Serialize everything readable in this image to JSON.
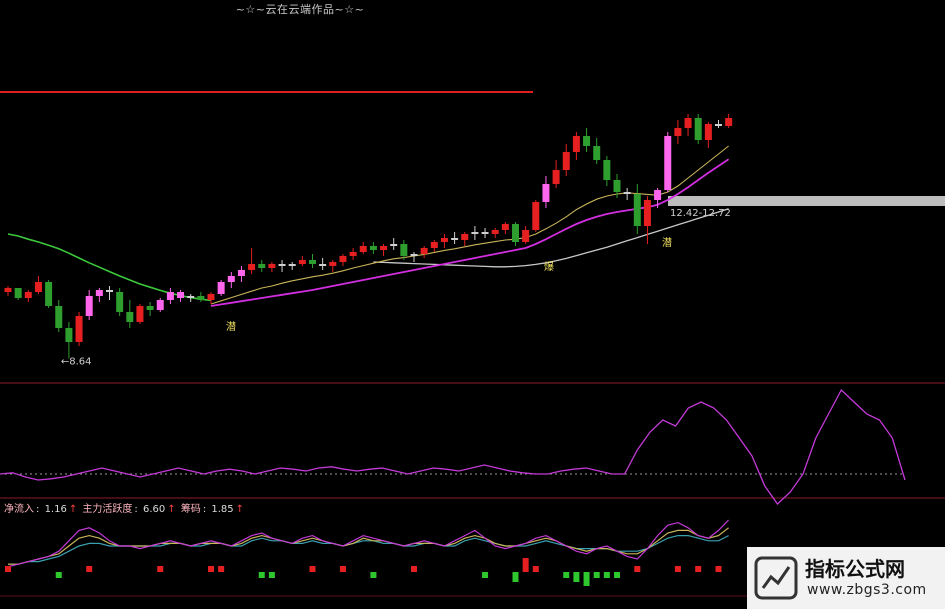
{
  "header": {
    "title": "~☆~云在云端作品~☆~"
  },
  "chart_data": {
    "type": "candlestick",
    "price_labels": {
      "low": "←8.64",
      "band": "12.42-12.72"
    },
    "signal_labels": {
      "qian": "潜",
      "bao": "爆"
    },
    "candles": [
      [
        10.3,
        10.45,
        10.2,
        10.4
      ],
      [
        10.4,
        10.4,
        10.1,
        10.15
      ],
      [
        10.15,
        10.35,
        10.05,
        10.3
      ],
      [
        10.3,
        10.7,
        10.25,
        10.55
      ],
      [
        10.55,
        10.6,
        9.9,
        9.95
      ],
      [
        9.95,
        10.1,
        9.3,
        9.4
      ],
      [
        9.4,
        9.55,
        8.64,
        9.05
      ],
      [
        9.05,
        9.8,
        8.95,
        9.7
      ],
      [
        9.7,
        10.35,
        9.6,
        10.2
      ],
      [
        10.2,
        10.4,
        10.05,
        10.35
      ],
      [
        10.35,
        10.45,
        10.1,
        10.3
      ],
      [
        10.3,
        10.4,
        9.7,
        9.8
      ],
      [
        9.8,
        10.1,
        9.4,
        9.55
      ],
      [
        9.55,
        10.0,
        9.5,
        9.95
      ],
      [
        9.95,
        10.05,
        9.7,
        9.85
      ],
      [
        9.85,
        10.15,
        9.8,
        10.1
      ],
      [
        10.1,
        10.4,
        10.0,
        10.3
      ],
      [
        10.3,
        10.35,
        10.05,
        10.15
      ],
      [
        10.15,
        10.25,
        10.05,
        10.2
      ],
      [
        10.2,
        10.3,
        10.05,
        10.1
      ],
      [
        10.1,
        10.3,
        10.0,
        10.25
      ],
      [
        10.25,
        10.6,
        10.2,
        10.55
      ],
      [
        10.55,
        10.8,
        10.4,
        10.7
      ],
      [
        10.7,
        10.95,
        10.55,
        10.85
      ],
      [
        10.85,
        11.4,
        10.75,
        11.0
      ],
      [
        11.0,
        11.1,
        10.8,
        10.9
      ],
      [
        10.9,
        11.05,
        10.8,
        11.0
      ],
      [
        11.0,
        11.1,
        10.8,
        10.95
      ],
      [
        10.95,
        11.05,
        10.85,
        11.0
      ],
      [
        11.0,
        11.2,
        10.95,
        11.1
      ],
      [
        11.1,
        11.25,
        10.9,
        11.0
      ],
      [
        11.0,
        11.15,
        10.85,
        10.95
      ],
      [
        10.95,
        11.1,
        10.8,
        11.05
      ],
      [
        11.05,
        11.25,
        10.95,
        11.2
      ],
      [
        11.2,
        11.4,
        11.1,
        11.3
      ],
      [
        11.3,
        11.55,
        11.25,
        11.45
      ],
      [
        11.45,
        11.55,
        11.25,
        11.35
      ],
      [
        11.35,
        11.5,
        11.2,
        11.45
      ],
      [
        11.45,
        11.65,
        11.35,
        11.5
      ],
      [
        11.5,
        11.6,
        11.1,
        11.2
      ],
      [
        11.2,
        11.3,
        11.05,
        11.25
      ],
      [
        11.25,
        11.45,
        11.15,
        11.4
      ],
      [
        11.4,
        11.6,
        11.3,
        11.55
      ],
      [
        11.55,
        11.75,
        11.4,
        11.65
      ],
      [
        11.65,
        11.8,
        11.5,
        11.6
      ],
      [
        11.6,
        11.8,
        11.45,
        11.75
      ],
      [
        11.75,
        11.95,
        11.6,
        11.8
      ],
      [
        11.8,
        11.9,
        11.65,
        11.75
      ],
      [
        11.75,
        11.9,
        11.65,
        11.85
      ],
      [
        11.85,
        12.05,
        11.75,
        12.0
      ],
      [
        12.0,
        12.05,
        11.45,
        11.55
      ],
      [
        11.55,
        11.95,
        11.5,
        11.85
      ],
      [
        11.85,
        12.6,
        11.8,
        12.55
      ],
      [
        12.55,
        13.2,
        12.4,
        13.0
      ],
      [
        13.0,
        13.6,
        12.9,
        13.35
      ],
      [
        13.35,
        14.0,
        13.2,
        13.8
      ],
      [
        13.8,
        14.3,
        13.6,
        14.2
      ],
      [
        14.2,
        14.4,
        13.8,
        13.95
      ],
      [
        13.95,
        14.15,
        13.5,
        13.6
      ],
      [
        13.6,
        13.7,
        12.95,
        13.1
      ],
      [
        13.1,
        13.25,
        12.65,
        12.8
      ],
      [
        12.8,
        12.9,
        12.6,
        12.75
      ],
      [
        12.75,
        13.0,
        11.75,
        11.95
      ],
      [
        11.95,
        12.7,
        11.5,
        12.6
      ],
      [
        12.6,
        12.9,
        12.4,
        12.85
      ],
      [
        12.85,
        14.3,
        12.8,
        14.2
      ],
      [
        14.2,
        14.6,
        14.0,
        14.4
      ],
      [
        14.4,
        14.75,
        14.2,
        14.65
      ],
      [
        14.65,
        14.75,
        14.0,
        14.1
      ],
      [
        14.1,
        14.55,
        13.9,
        14.5
      ],
      [
        14.5,
        14.6,
        14.4,
        14.45
      ],
      [
        14.45,
        14.75,
        14.4,
        14.65
      ]
    ],
    "ma_gold": [
      null,
      null,
      null,
      null,
      null,
      null,
      null,
      null,
      null,
      null,
      null,
      null,
      null,
      null,
      null,
      null,
      null,
      null,
      null,
      null,
      10.0,
      10.08,
      10.16,
      10.24,
      10.32,
      10.4,
      10.45,
      10.52,
      10.58,
      10.63,
      10.68,
      10.72,
      10.77,
      10.83,
      10.9,
      10.96,
      11.02,
      11.08,
      11.13,
      11.16,
      11.2,
      11.24,
      11.29,
      11.34,
      11.38,
      11.43,
      11.48,
      11.52,
      11.56,
      11.6,
      11.62,
      11.66,
      11.75,
      11.88,
      12.02,
      12.18,
      12.36,
      12.5,
      12.62,
      12.7,
      12.75,
      12.78,
      12.76,
      12.74,
      12.72,
      12.8,
      12.95,
      13.15,
      13.35,
      13.55,
      13.75,
      13.95
    ],
    "ma_purple": [
      null,
      null,
      null,
      null,
      null,
      null,
      null,
      null,
      null,
      null,
      null,
      null,
      null,
      null,
      null,
      null,
      null,
      null,
      null,
      null,
      9.95,
      9.99,
      10.03,
      10.07,
      10.11,
      10.15,
      10.19,
      10.23,
      10.27,
      10.31,
      10.35,
      10.4,
      10.45,
      10.5,
      10.55,
      10.6,
      10.65,
      10.7,
      10.75,
      10.8,
      10.85,
      10.9,
      10.95,
      11.0,
      11.05,
      11.1,
      11.15,
      11.2,
      11.25,
      11.3,
      11.35,
      11.4,
      11.5,
      11.62,
      11.75,
      11.88,
      12.0,
      12.1,
      12.18,
      12.25,
      12.3,
      12.34,
      12.38,
      12.42,
      12.48,
      12.6,
      12.75,
      12.92,
      13.1,
      13.28,
      13.45,
      13.62
    ],
    "ma_green": [
      11.75,
      11.7,
      11.62,
      11.55,
      11.47,
      11.38,
      11.27,
      11.15,
      11.03,
      10.92,
      10.81,
      10.7,
      10.6,
      10.5,
      10.42,
      10.34,
      10.27,
      10.21,
      10.16,
      10.12,
      10.09
    ],
    "ma_gray": [
      null,
      null,
      null,
      null,
      null,
      null,
      null,
      null,
      null,
      null,
      null,
      null,
      null,
      null,
      null,
      null,
      null,
      null,
      null,
      null,
      null,
      null,
      null,
      null,
      null,
      null,
      null,
      null,
      null,
      null,
      null,
      null,
      null,
      null,
      null,
      null,
      11.05,
      11.04,
      11.03,
      11.02,
      11.01,
      11.0,
      10.99,
      10.98,
      10.97,
      10.96,
      10.95,
      10.94,
      10.93,
      10.93,
      10.94,
      10.96,
      10.99,
      11.03,
      11.08,
      11.14,
      11.21,
      11.28,
      11.35,
      11.42,
      11.5,
      11.58,
      11.66,
      11.74,
      11.82,
      11.9,
      11.98,
      12.06,
      12.14,
      12.22,
      12.3,
      12.38
    ],
    "osc": [
      0,
      0.2,
      -0.5,
      -1,
      -0.8,
      -0.5,
      0,
      0.5,
      1,
      0.5,
      0,
      -0.5,
      0,
      0.5,
      1,
      0.5,
      0,
      0.5,
      0.8,
      0.5,
      0,
      0.5,
      1,
      0.8,
      0.5,
      1,
      1.2,
      0.8,
      0.5,
      0.8,
      1,
      0.5,
      0,
      0.5,
      1,
      0.8,
      0.5,
      1,
      1.5,
      1,
      0.5,
      0.2,
      0,
      0,
      0.5,
      0.8,
      1,
      0.5,
      0,
      0,
      4,
      7,
      9,
      8,
      11,
      12,
      11,
      9,
      6,
      3,
      -2,
      -5,
      -3,
      0,
      6,
      10,
      14,
      12,
      10,
      9,
      6,
      -1
    ],
    "panel3": {
      "labels": [
        {
          "name": "净流入",
          "value": "1.16"
        },
        {
          "name": "主力活跃度",
          "value": "6.60"
        },
        {
          "name": "筹码",
          "value": "1.85"
        }
      ],
      "arrow": "↑",
      "line_purple": [
        2,
        3,
        4,
        5,
        6,
        8,
        12,
        16,
        17,
        15,
        12,
        10,
        10,
        9,
        10,
        11,
        12,
        11,
        10,
        11,
        12,
        11,
        10,
        12,
        14,
        15,
        13,
        12,
        11,
        13,
        14,
        12,
        11,
        10,
        12,
        14,
        13,
        12,
        11,
        10,
        11,
        12,
        11,
        10,
        12,
        14,
        16,
        13,
        10,
        9,
        10,
        11,
        13,
        14,
        12,
        10,
        8,
        7,
        9,
        10,
        8,
        6,
        5,
        9,
        14,
        18,
        19,
        17,
        14,
        13,
        16,
        20
      ],
      "line_gold": [
        3,
        3,
        4,
        5,
        6,
        7,
        10,
        13,
        14,
        13,
        11,
        10,
        10,
        10,
        10,
        11,
        11,
        11,
        10,
        11,
        11,
        11,
        10,
        11,
        13,
        14,
        13,
        12,
        11,
        12,
        13,
        12,
        11,
        10,
        11,
        13,
        12,
        12,
        11,
        10,
        11,
        11,
        11,
        10,
        11,
        13,
        14,
        13,
        11,
        10,
        10,
        11,
        12,
        13,
        12,
        10,
        9,
        8,
        9,
        9,
        8,
        7,
        7,
        9,
        12,
        15,
        16,
        16,
        14,
        13,
        14,
        17
      ],
      "line_cyan": [
        3,
        3,
        4,
        4,
        5,
        6,
        8,
        10,
        11,
        11,
        10,
        10,
        10,
        10,
        10,
        10,
        11,
        11,
        10,
        10,
        11,
        11,
        10,
        10,
        12,
        13,
        12,
        12,
        11,
        11,
        12,
        11,
        11,
        10,
        11,
        12,
        12,
        11,
        11,
        10,
        10,
        11,
        11,
        10,
        10,
        12,
        13,
        12,
        11,
        10,
        10,
        10,
        11,
        12,
        11,
        10,
        9,
        9,
        9,
        9,
        8,
        8,
        8,
        9,
        11,
        13,
        14,
        14,
        13,
        12,
        12,
        14
      ],
      "bars": [
        1,
        0,
        0,
        0,
        0,
        -1,
        0,
        0,
        1,
        0,
        0,
        0,
        0,
        0,
        0,
        1,
        0,
        0,
        0,
        0,
        1,
        1,
        0,
        0,
        0,
        -1,
        -1,
        0,
        0,
        0,
        1,
        0,
        0,
        1,
        0,
        0,
        -1,
        0,
        0,
        0,
        1,
        0,
        0,
        0,
        0,
        0,
        0,
        -1,
        0,
        0,
        -2,
        3,
        1,
        0,
        0,
        -1,
        -2,
        -3,
        -1,
        -1,
        -1,
        0,
        1,
        0,
        0,
        0,
        1,
        0,
        1,
        0,
        1,
        0
      ]
    }
  },
  "watermark": {
    "name": "指标公式网",
    "url": "www.zbgs3.com"
  }
}
